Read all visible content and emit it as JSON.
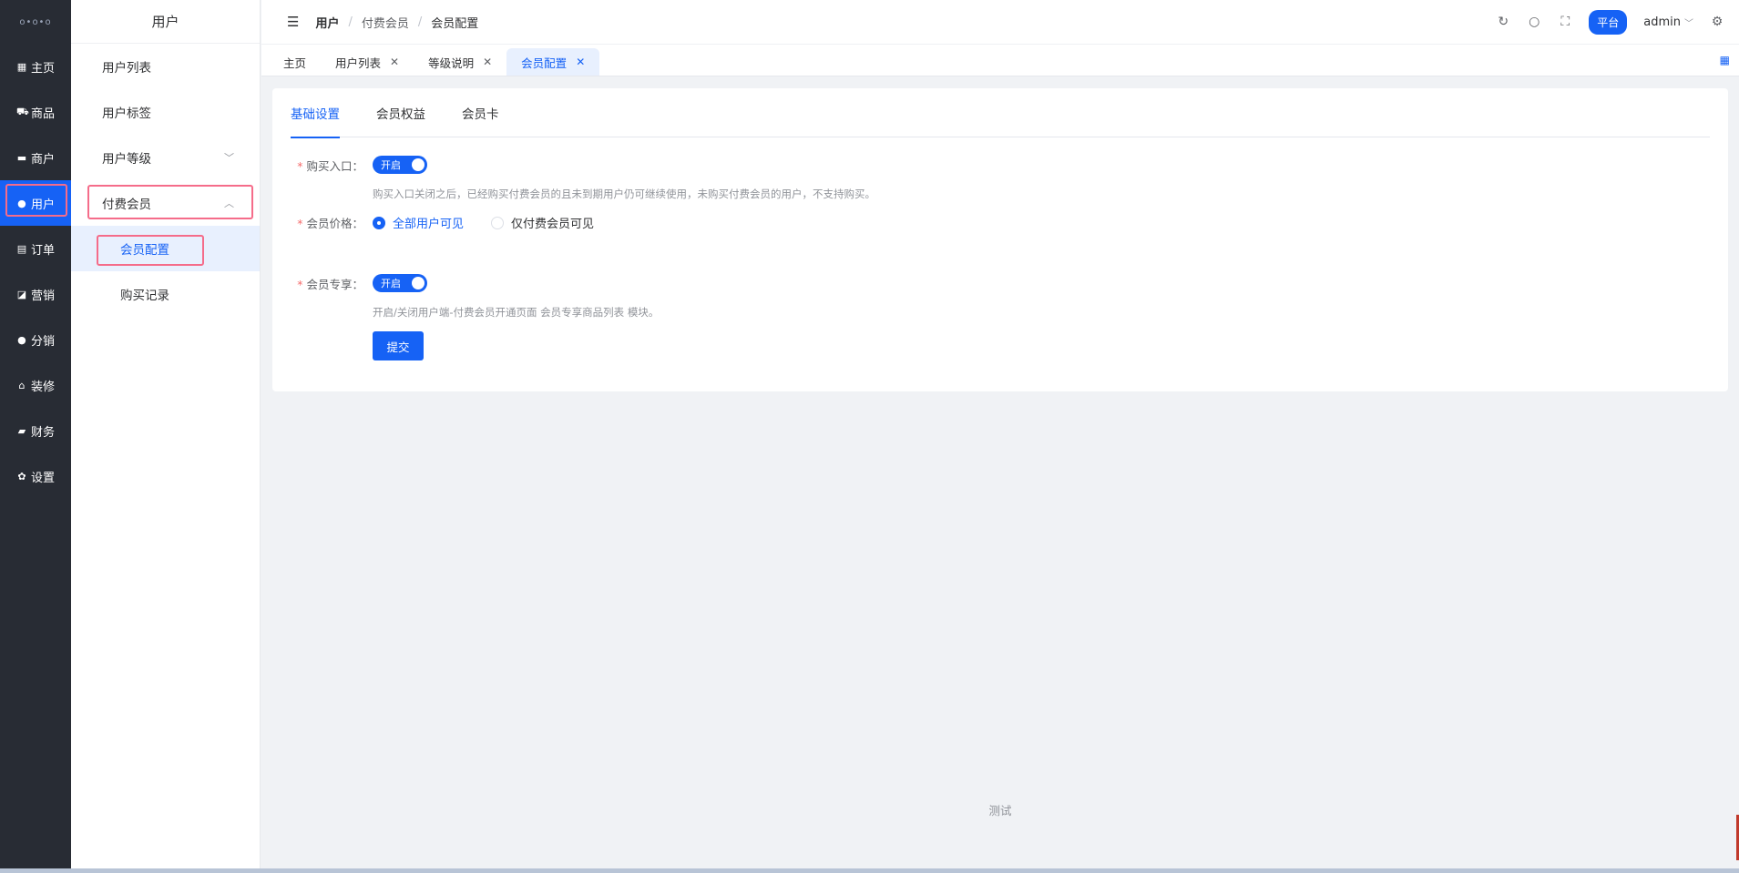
{
  "rail": {
    "logo": "o•o•o",
    "items": [
      {
        "icon": "▦",
        "label": "主页"
      },
      {
        "icon": "⛟",
        "label": "商品"
      },
      {
        "icon": "▬",
        "label": "商户"
      },
      {
        "icon": "●",
        "label": "用户"
      },
      {
        "icon": "▤",
        "label": "订单"
      },
      {
        "icon": "◪",
        "label": "营销"
      },
      {
        "icon": "●",
        "label": "分销"
      },
      {
        "icon": "⌂",
        "label": "装修"
      },
      {
        "icon": "▰",
        "label": "财务"
      },
      {
        "icon": "✿",
        "label": "设置"
      }
    ],
    "active_index": 3
  },
  "submenu": {
    "title": "用户",
    "items": [
      {
        "label": "用户列表"
      },
      {
        "label": "用户标签"
      },
      {
        "label": "用户等级",
        "chevron": "﹀"
      },
      {
        "label": "付费会员",
        "chevron": "︿"
      }
    ],
    "children": [
      {
        "label": "会员配置"
      },
      {
        "label": "购买记录"
      }
    ]
  },
  "header": {
    "menu_icon": "☰",
    "breadcrumb": [
      "用户",
      "付费会员",
      "会员配置"
    ],
    "separator": "/",
    "icons": {
      "refresh": "↻",
      "search": "○",
      "fullscreen": "⛶",
      "settings": "⚙"
    },
    "platform": "平台",
    "user": "admin",
    "user_chevron": "﹀"
  },
  "tabs": [
    {
      "label": "主页",
      "close": ""
    },
    {
      "label": "用户列表",
      "close": "✕"
    },
    {
      "label": "等级说明",
      "close": "✕"
    },
    {
      "label": "会员配置",
      "close": "✕"
    }
  ],
  "tabs_grid_icon": "▦",
  "card": {
    "tabs": [
      "基础设置",
      "会员权益",
      "会员卡"
    ],
    "form": {
      "buy_entry_label": "购买入口：",
      "buy_entry_switch": "开启",
      "buy_entry_hint": "购买入口关闭之后，已经购买付费会员的且未到期用户仍可继续使用，未购买付费会员的用户，不支持购买。",
      "price_label": "会员价格：",
      "price_options": [
        "全部用户可见",
        "仅付费会员可见"
      ],
      "exclusive_label": "会员专享：",
      "exclusive_switch": "开启",
      "exclusive_hint": "开启/关闭用户端-付费会员开通页面 会员专享商品列表 模块。",
      "required_mark": "*",
      "submit": "提交"
    }
  },
  "footer": "测试",
  "colors": {
    "primary": "#1662f5",
    "rail": "#282c34",
    "highlight": "#f56c8a"
  }
}
